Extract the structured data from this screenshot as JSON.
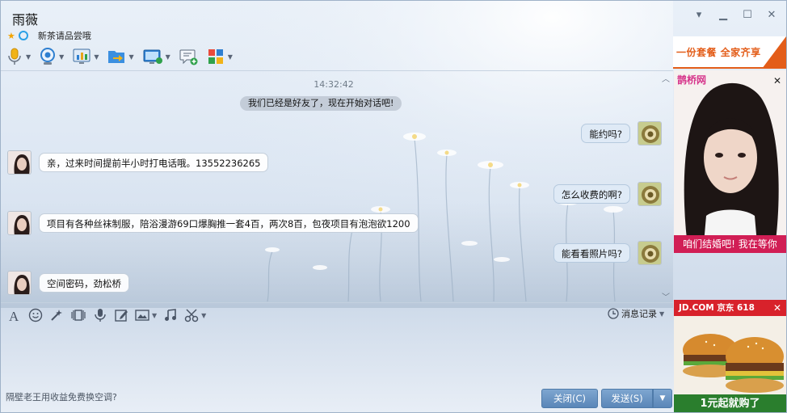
{
  "header": {
    "contact_name": "雨薇",
    "signature": "新茶请品尝哦",
    "window_controls": [
      "chevron-down-icon",
      "minimize-icon",
      "maximize-icon",
      "close-icon"
    ]
  },
  "toolbar": {
    "items": [
      "microphone-icon",
      "webcam-icon",
      "screen-share-icon",
      "file-transfer-icon",
      "remote-desktop-icon",
      "add-message-icon",
      "apps-icon"
    ]
  },
  "chat": {
    "timestamp": "14:32:42",
    "system_message": "我们已经是好友了，现在开始对话吧!",
    "messages": [
      {
        "from": "me",
        "text": "能约吗?"
      },
      {
        "from": "other",
        "text": "亲，过来时间提前半小时打电话哦。13552236265"
      },
      {
        "from": "me",
        "text": "怎么收费的啊?"
      },
      {
        "from": "other",
        "text": "项目有各种丝袜制服，陪浴漫游69口爆胸推一套4百，两次8百，包夜项目有泡泡欲1200"
      },
      {
        "from": "me",
        "text": "能看看照片吗?"
      },
      {
        "from": "other",
        "text": "空间密码，劲松桥"
      }
    ]
  },
  "input_toolbar": {
    "items": [
      "font-icon",
      "emoji-icon",
      "magic-icon",
      "shake-icon",
      "voice-message-icon",
      "edit-icon",
      "picture-icon",
      "music-icon",
      "screenshot-icon"
    ],
    "history_label": "消息记录"
  },
  "footer": {
    "tip": "隔壁老王用收益免费换空调?",
    "close_label": "关闭(C)",
    "send_label": "发送(S)"
  },
  "ads": {
    "banner_text": "一份套餐  全家齐享",
    "portrait_brand": "鹊桥网",
    "portrait_caption": "咱们结婚吧! 我在等你",
    "food_header": "JD.COM 京东  618",
    "food_promo": "1元起就购了"
  },
  "colors": {
    "accent": "#5a86b8",
    "ad_pink": "#d11e55",
    "ad_orange": "#e35d19"
  }
}
